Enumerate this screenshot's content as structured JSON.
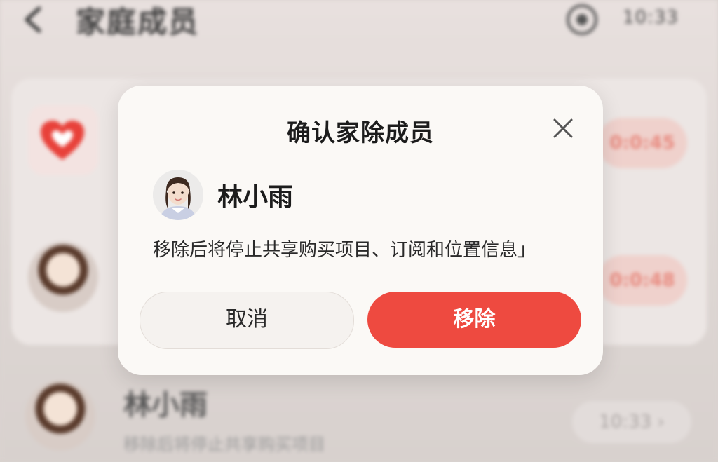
{
  "background": {
    "header": {
      "title": "家庭成员",
      "time": "10:33"
    },
    "rows": [
      {
        "pill": "0:0:45"
      },
      {
        "pill": "0:0:48"
      },
      {
        "name": "林小雨",
        "subtitle": "移除后将停止共享购买项目",
        "time": "10:33 ›"
      }
    ]
  },
  "dialog": {
    "title": "确认家除成员",
    "member_name": "林小雨",
    "message": "移除后将停止共享购买项目、订阅和位置信息」",
    "cancel_label": "取消",
    "remove_label": "移除"
  },
  "colors": {
    "accent": "#ee4a40",
    "dialog_bg": "#fbf9f6",
    "cancel_bg": "#f5f2ef"
  },
  "icons": {
    "back": "back-arrow-icon",
    "target": "record-icon",
    "heart": "heart-icon",
    "close": "close-icon"
  }
}
